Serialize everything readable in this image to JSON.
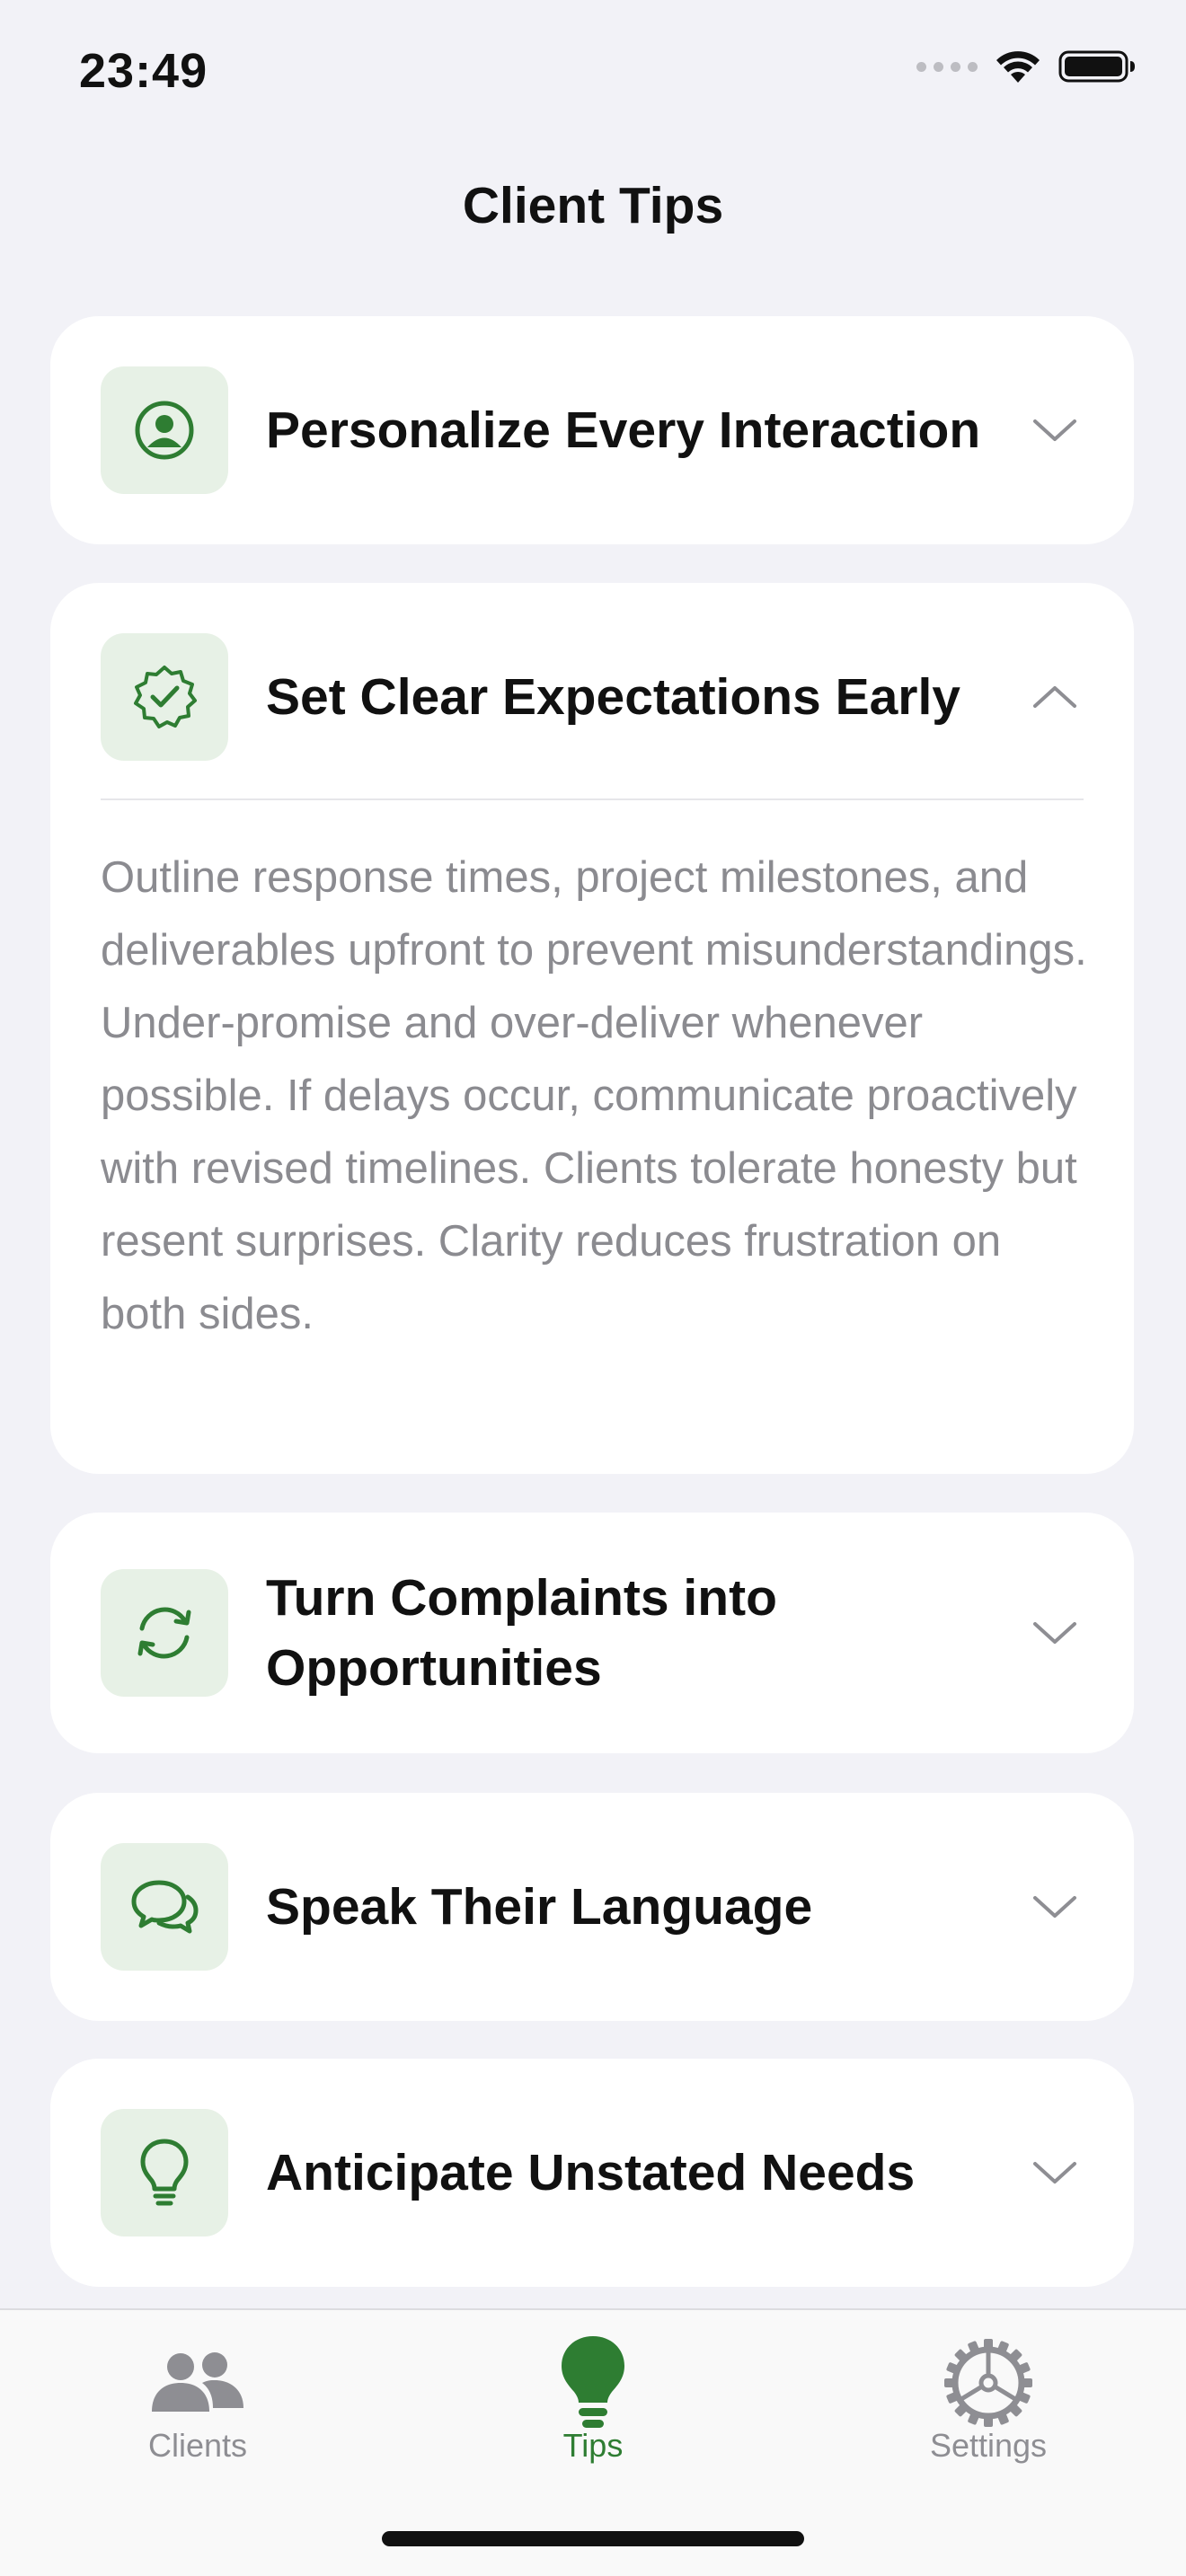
{
  "status_bar": {
    "time": "23:49",
    "icons": [
      "cellular-signal-icon",
      "wifi-icon",
      "battery-icon"
    ]
  },
  "nav": {
    "title": "Client Tips"
  },
  "tips": [
    {
      "title": "Personalize Every Interaction",
      "icon": "person-circle-icon",
      "expanded": false
    },
    {
      "title": "Set Clear Expectations Early",
      "icon": "checkmark-seal-icon",
      "expanded": true,
      "body": "Outline response times, project milestones, and deliverables upfront to prevent misunderstandings. Under-promise and over-deliver whenever possible. If delays occur, communicate proactively with revised timelines. Clients tolerate honesty but resent surprises. Clarity reduces frustration on both sides."
    },
    {
      "title": "Turn Complaints into Opportunities",
      "icon": "arrows-circle-icon",
      "expanded": false
    },
    {
      "title": "Speak Their Language",
      "icon": "chat-bubbles-icon",
      "expanded": false
    },
    {
      "title": "Anticipate Unstated Needs",
      "icon": "lightbulb-icon",
      "expanded": false
    }
  ],
  "tab_bar": {
    "tabs": [
      {
        "label": "Clients",
        "icon": "people-icon",
        "selected": false
      },
      {
        "label": "Tips",
        "icon": "lightbulb-fill-icon",
        "selected": true
      },
      {
        "label": "Settings",
        "icon": "gear-icon",
        "selected": false
      }
    ]
  },
  "colors": {
    "accent": "#2e7d32",
    "icon_tile_bg": "#e7f1e6",
    "background": "#f2f2f7",
    "card": "#ffffff",
    "secondary_text": "#8b8b90",
    "inactive_tab": "#8e8e93"
  }
}
